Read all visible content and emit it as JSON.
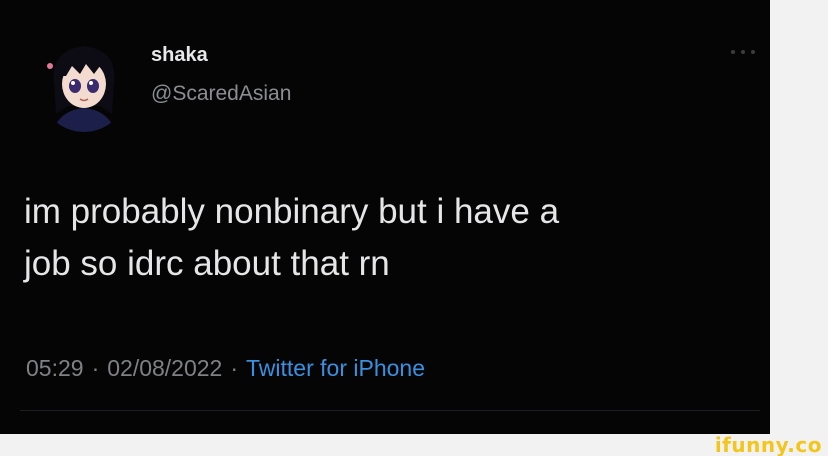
{
  "tweet": {
    "display_name": "shaka",
    "handle": "@ScaredAsian",
    "text_lines": [
      "im probably nonbinary but i have a",
      "job so idrc about that rn"
    ],
    "time": "05:29",
    "date": "02/08/2022",
    "separator": "·",
    "source": "Twitter for iPhone",
    "avatar_icon": "anime-avatar",
    "more_icon": "more-options-icon"
  },
  "watermark": {
    "text": "ifunny.co"
  },
  "colors": {
    "background": "#000000",
    "name": "#e8e8ea",
    "handle": "#8b8d91",
    "body_text": "#e6e6e8",
    "meta": "#7f8185",
    "link": "#3a8fe0",
    "watermark": "#f4c51a"
  }
}
